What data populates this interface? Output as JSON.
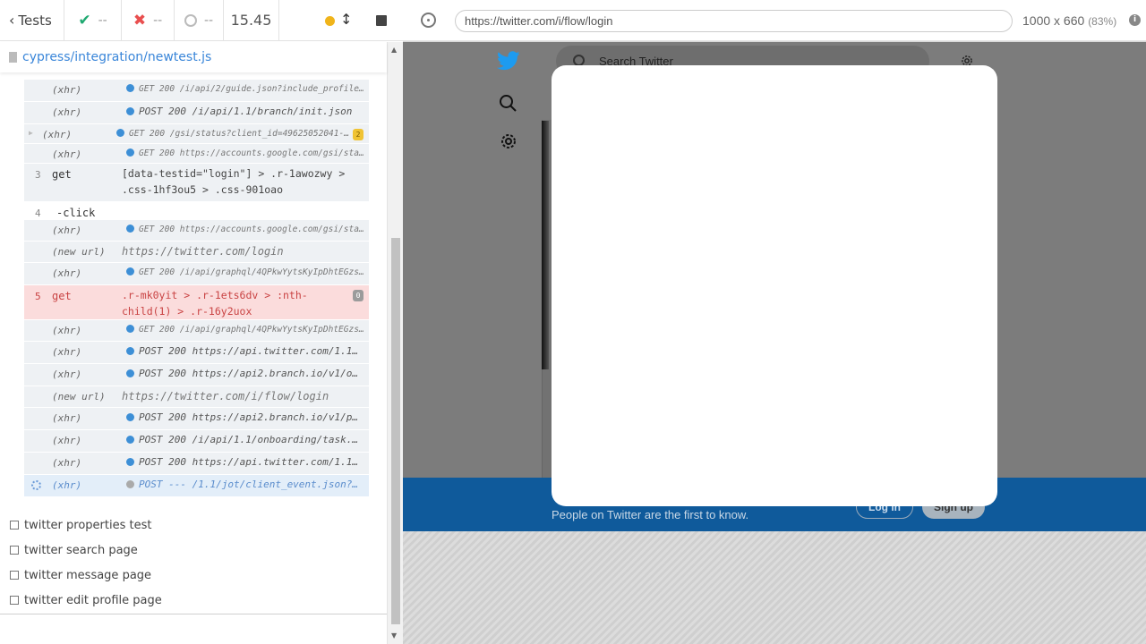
{
  "header": {
    "tests_label": "Tests",
    "passed": "--",
    "failed": "--",
    "pending": "--",
    "duration": "15.45"
  },
  "spec": {
    "path": "cypress/integration/newtest.js"
  },
  "commands": [
    {
      "name": "(xhr)",
      "msg": "GET 200 /i/api/2/guide.json?include_profile…"
    },
    {
      "name": "(xhr)",
      "msg": "POST 200 /i/api/1.1/branch/init.json"
    },
    {
      "name": "(xhr)",
      "msg": "GET 200 /gsi/status?client_id=49625052041-k…",
      "badge": "2"
    },
    {
      "name": "(xhr)",
      "msg": "GET 200 https://accounts.google.com/gsi/sta…"
    },
    {
      "num": "3",
      "name": "get",
      "msg": "[data-testid=\"login\"] > .r-1awozwy > .css-1hf3ou5 > .css-901oao"
    },
    {
      "num": "4",
      "name": "-click"
    },
    {
      "name": "(xhr)",
      "msg": "GET 200 https://accounts.google.com/gsi/sta…"
    },
    {
      "name": "(new url)",
      "msg": "https://twitter.com/login"
    },
    {
      "name": "(xhr)",
      "msg": "GET 200 /i/api/graphql/4QPkwYytsKyIpDhtEGzs…"
    },
    {
      "num": "5",
      "name": "get",
      "msg": ".r-mk0yit > .r-1ets6dv > :nth-child(1) > .r-16y2uox",
      "badge": "0"
    },
    {
      "name": "(xhr)",
      "msg": "GET 200 /i/api/graphql/4QPkwYytsKyIpDhtEGzs…"
    },
    {
      "name": "(xhr)",
      "msg": "POST 200 https://api.twitter.com/1.1…"
    },
    {
      "name": "(xhr)",
      "msg": "POST 200 https://api2.branch.io/v1/o…"
    },
    {
      "name": "(new url)",
      "msg": "https://twitter.com/i/flow/login"
    },
    {
      "name": "(xhr)",
      "msg": "POST 200 https://api2.branch.io/v1/p…"
    },
    {
      "name": "(xhr)",
      "msg": "POST 200 /i/api/1.1/onboarding/task.…"
    },
    {
      "name": "(xhr)",
      "msg": "POST 200 https://api.twitter.com/1.1…"
    },
    {
      "name": "(xhr)",
      "msg": "POST --- /1.1/jot/client_event.json?…"
    }
  ],
  "tests": [
    "twitter properties test",
    "twitter search page",
    "twitter message page",
    "twitter edit profile page"
  ],
  "browser": {
    "url": "https://twitter.com/i/flow/login",
    "viewport": "1000 x 660",
    "scale": "(83%)",
    "info": "i"
  },
  "twitter": {
    "search_placeholder": "Search Twitter",
    "banner_text": "People on Twitter are the first to know.",
    "login_label": "Log in",
    "signup_label": "Sign up"
  },
  "colors": {
    "accent": "#3a86d9",
    "pass": "#1fa971",
    "fail": "#e94f4f",
    "twitter_blue": "#1d9bf0"
  }
}
